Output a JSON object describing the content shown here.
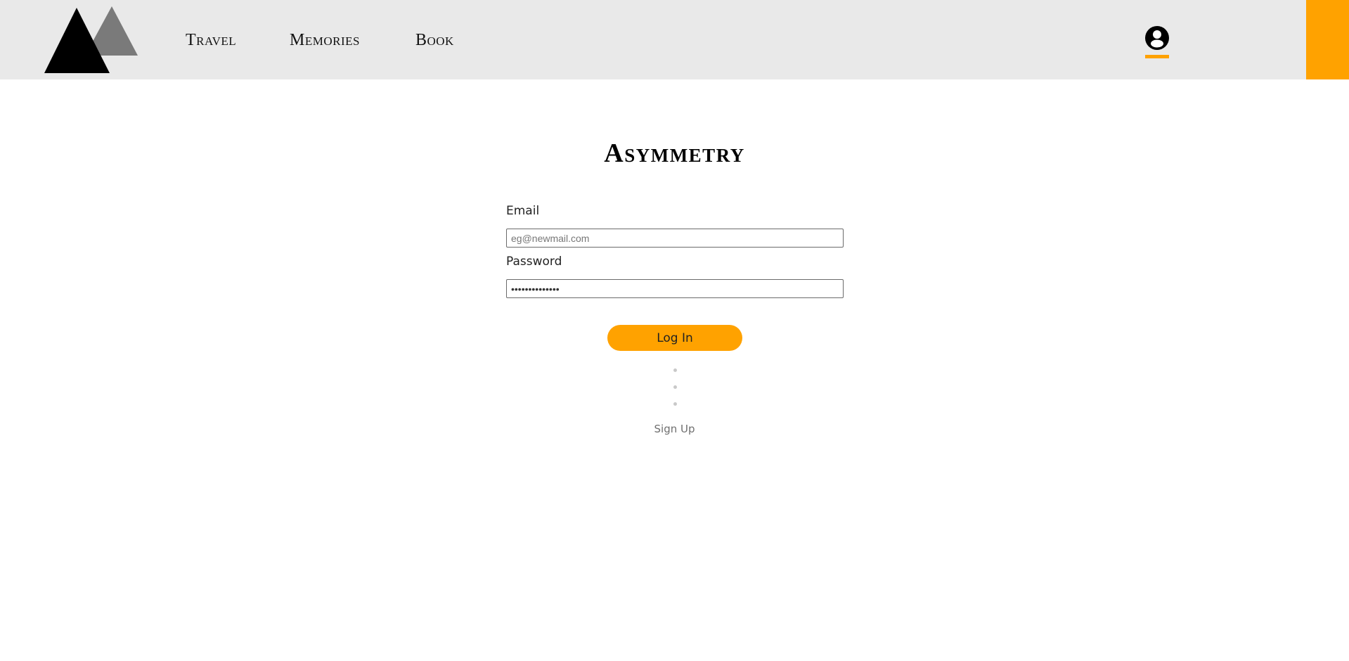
{
  "header": {
    "logo_icon": "triangles-logo-icon",
    "nav": [
      {
        "label": "Travel"
      },
      {
        "label": "Memories"
      },
      {
        "label": "Book"
      }
    ],
    "account_icon": "user-account-icon"
  },
  "main": {
    "title": "Asymmetry",
    "email": {
      "label": "Email",
      "placeholder": "eg@newmail.com",
      "value": ""
    },
    "password": {
      "label": "Password",
      "value": "••••••••••••••"
    },
    "login_label": "Log In",
    "signup_label": "Sign Up"
  },
  "colors": {
    "accent": "#ffa200",
    "header_bg": "#e9e9e9",
    "logo_dark": "#000000",
    "logo_light": "#7a7a7a"
  }
}
